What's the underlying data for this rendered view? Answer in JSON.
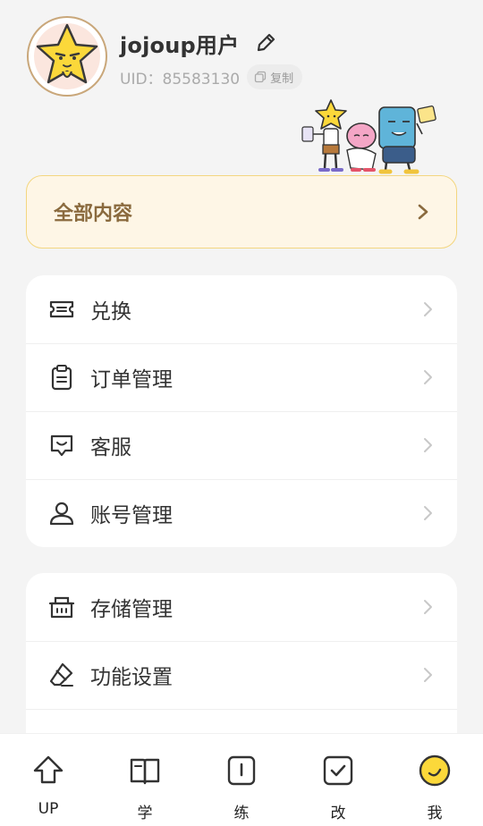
{
  "profile": {
    "username": "jojoup用户",
    "uid": "UID：85583130",
    "copy_label": "复制"
  },
  "all_content": {
    "label": "全部内容"
  },
  "menu_group_1": [
    {
      "label": "兑换",
      "icon": "ticket-icon"
    },
    {
      "label": "订单管理",
      "icon": "clipboard-icon"
    },
    {
      "label": "客服",
      "icon": "chat-smile-icon"
    },
    {
      "label": "账号管理",
      "icon": "user-icon"
    }
  ],
  "menu_group_2": [
    {
      "label": "存储管理",
      "icon": "storage-icon"
    },
    {
      "label": "功能设置",
      "icon": "eraser-icon"
    }
  ],
  "tabbar": [
    {
      "label": "UP",
      "icon": "up-arrow-icon"
    },
    {
      "label": "学",
      "icon": "book-icon"
    },
    {
      "label": "练",
      "icon": "practice-icon"
    },
    {
      "label": "改",
      "icon": "check-box-icon"
    },
    {
      "label": "我",
      "icon": "smile-face-icon",
      "active": true
    }
  ],
  "colors": {
    "accent_yellow": "#fbd83a",
    "card_gold_text": "#8a6a3e",
    "card_gold_bg": "#fef6e6",
    "card_gold_border": "#f3d680"
  }
}
